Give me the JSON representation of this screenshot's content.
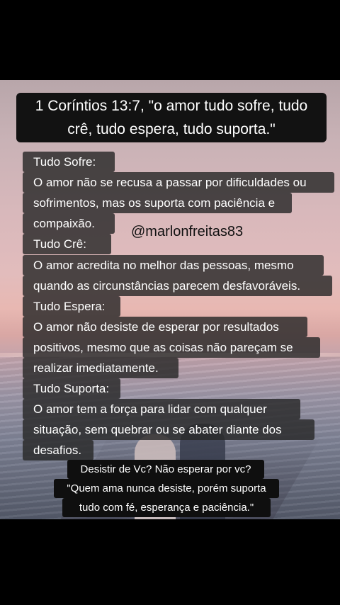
{
  "title": {
    "line1": "1 Coríntios 13:7, \"o amor tudo sofre, tudo",
    "line2": "crê, tudo espera, tudo suporta.\""
  },
  "watermark": "@marlonfreitas83",
  "lines": [
    "Tudo Sofre:",
    "O amor não se recusa a passar por dificuldades ou",
    "sofrimentos, mas os suporta com paciência e",
    "compaixão.",
    "Tudo Crê:",
    "O amor acredita no melhor das pessoas, mesmo",
    "quando as circunstâncias parecem desfavoráveis.",
    "Tudo Espera:",
    "O amor não desiste de esperar por resultados",
    "positivos, mesmo que as coisas não pareçam se",
    "realizar imediatamente.",
    "Tudo Suporta:",
    "O amor tem a força para lidar com qualquer",
    "situação, sem quebrar ou se abater diante dos",
    "desafios."
  ],
  "footer": [
    "Desistir de Vc?  Não esperar por vc?",
    "\"Quem ama nunca desiste, porém suporta",
    "tudo com fé, esperança e paciência.\""
  ]
}
